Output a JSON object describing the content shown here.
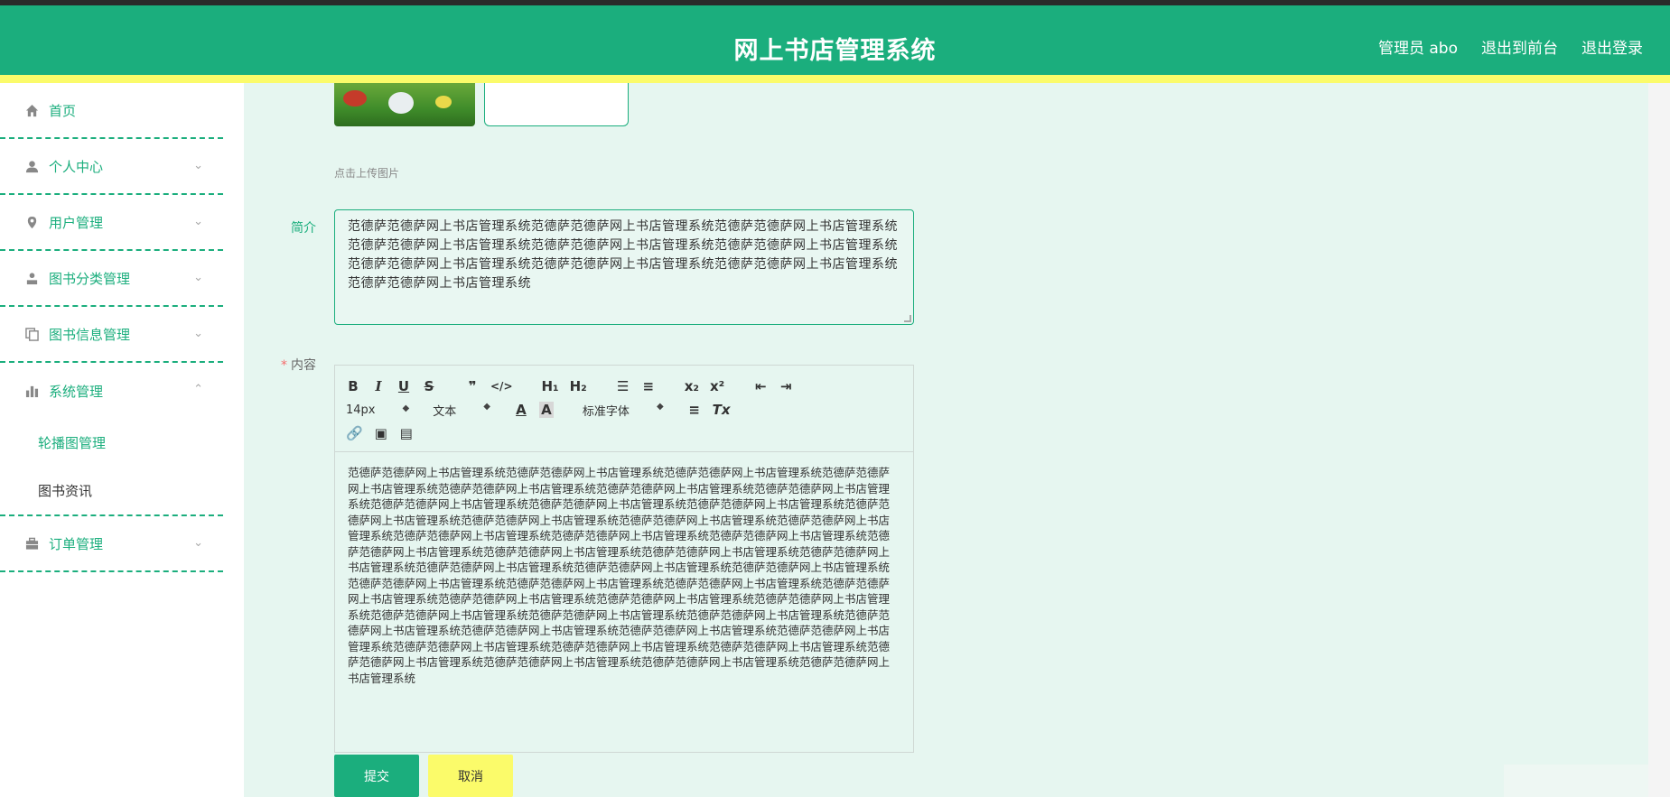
{
  "header": {
    "title": "网上书店管理系统",
    "links": [
      "管理员 abo",
      "退出到前台",
      "退出登录"
    ]
  },
  "sidebar": {
    "items": [
      {
        "label": "首页",
        "icon": "home-icon"
      },
      {
        "label": "个人中心",
        "icon": "user-icon",
        "arrow": "⌄"
      },
      {
        "label": "用户管理",
        "icon": "location-icon",
        "arrow": "⌄"
      },
      {
        "label": "图书分类管理",
        "icon": "person-icon",
        "arrow": "⌄"
      },
      {
        "label": "图书信息管理",
        "icon": "copy-icon",
        "arrow": "⌄"
      },
      {
        "label": "系统管理",
        "icon": "bar-chart-icon",
        "arrow": "⌃"
      },
      {
        "label": "订单管理",
        "icon": "briefcase-icon",
        "arrow": "⌄"
      }
    ],
    "submenu": [
      {
        "label": "轮播图管理"
      },
      {
        "label": "图书资讯"
      }
    ]
  },
  "form": {
    "upload_hint": "点击上传图片",
    "intro_label": "简介",
    "intro_value": "范德萨范德萨网上书店管理系统范德萨范德萨网上书店管理系统范德萨范德萨网上书店管理系统范德萨范德萨网上书店管理系统范德萨范德萨网上书店管理系统范德萨范德萨网上书店管理系统范德萨范德萨网上书店管理系统范德萨范德萨网上书店管理系统范德萨范德萨网上书店管理系统范德萨范德萨网上书店管理系统",
    "content_required": "*",
    "content_label": "内容",
    "toolbar": {
      "font_size": "14px",
      "text_type": "文本",
      "font_family": "标准字体"
    },
    "content_value": "范德萨范德萨网上书店管理系统范德萨范德萨网上书店管理系统范德萨范德萨网上书店管理系统范德萨范德萨网上书店管理系统范德萨范德萨网上书店管理系统范德萨范德萨网上书店管理系统范德萨范德萨网上书店管理系统范德萨范德萨网上书店管理系统范德萨范德萨网上书店管理系统范德萨范德萨网上书店管理系统范德萨范德萨网上书店管理系统范德萨范德萨网上书店管理系统范德萨范德萨网上书店管理系统范德萨范德萨网上书店管理系统范德萨范德萨网上书店管理系统范德萨范德萨网上书店管理系统范德萨范德萨网上书店管理系统范德萨范德萨网上书店管理系统范德萨范德萨网上书店管理系统范德萨范德萨网上书店管理系统范德萨范德萨网上书店管理系统范德萨范德萨网上书店管理系统范德萨范德萨网上书店管理系统范德萨范德萨网上书店管理系统范德萨范德萨网上书店管理系统范德萨范德萨网上书店管理系统范德萨范德萨网上书店管理系统范德萨范德萨网上书店管理系统范德萨范德萨网上书店管理系统范德萨范德萨网上书店管理系统范德萨范德萨网上书店管理系统范德萨范德萨网上书店管理系统范德萨范德萨网上书店管理系统范德萨范德萨网上书店管理系统范德萨范德萨网上书店管理系统范德萨范德萨网上书店管理系统范德萨范德萨网上书店管理系统范德萨范德萨网上书店管理系统范德萨范德萨网上书店管理系统范德萨范德萨网上书店管理系统范德萨范德萨网上书店管理系统范德萨范德萨网上书店管理系统范德萨范德萨网上书店管理系统范德萨范德萨网上书店管理系统范德萨范德萨网上书店管理系统",
    "submit_label": "提交",
    "cancel_label": "取消"
  },
  "colors": {
    "primary": "#1bae7d",
    "accent": "#fbfb6a",
    "main_bg": "#e6f6f0"
  }
}
